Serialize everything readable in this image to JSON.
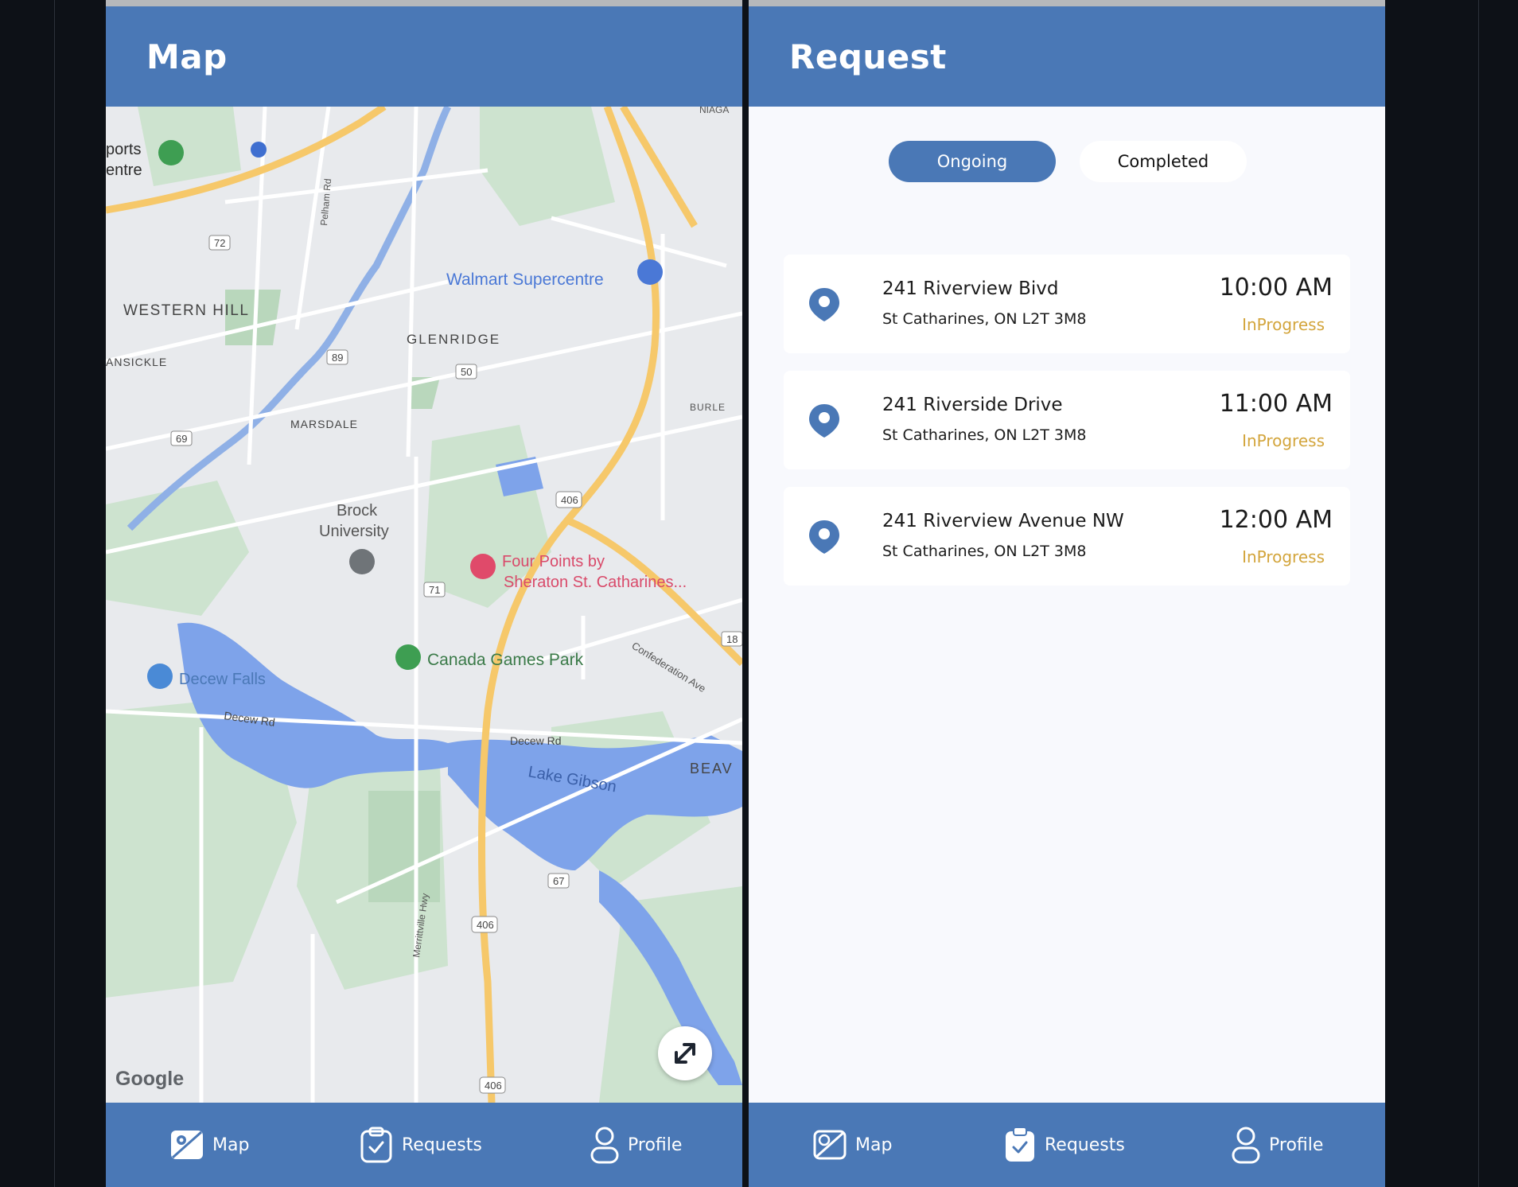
{
  "colors": {
    "brand_blue": "#4a78b6",
    "status_inprogress": "#d3a53c",
    "background_dark": "#0d1117",
    "screen_bg": "#f8f9fd"
  },
  "map_screen": {
    "title": "Map",
    "map_labels": {
      "sports_centre_1": "ports",
      "sports_centre_2": "entre",
      "western_hill": "WESTERN HILL",
      "glenridge": "GLENRIDGE",
      "ansickle": "ANSICKLE",
      "marsdale": "MARSDALE",
      "brock_1": "Brock",
      "brock_2": "University",
      "walmart": "Walmart Supercentre",
      "four_points_1": "Four Points by",
      "four_points_2": "Sheraton St. Catharines...",
      "canada_games": "Canada Games Park",
      "decew_falls": "Decew Falls",
      "decew_rd_1": "Decew Rd",
      "decew_rd_2": "Decew Rd",
      "lake_gibson": "Lake Gibson",
      "confederation": "Confederation Ave",
      "beav": "BEAV",
      "burle": "BURLE",
      "merrittville": "Merrittville Hwy",
      "pelham": "Pelham Rd",
      "niagara": "NIAGA",
      "hwy_406_a": "406",
      "hwy_406_b": "406",
      "hwy_406_c": "406",
      "rd_72": "72",
      "rd_89": "89",
      "rd_50": "50",
      "rd_69": "69",
      "rd_71": "71",
      "rd_67": "67",
      "rd_18": "18"
    },
    "google_logo": "Google",
    "nav": {
      "map": "Map",
      "requests": "Requests",
      "profile": "Profile"
    }
  },
  "request_screen": {
    "title": "Request",
    "tabs": {
      "ongoing": "Ongoing",
      "completed": "Completed"
    },
    "requests": [
      {
        "address": "241 Riverview Bivd",
        "city": "St Catharines, ON L2T 3M8",
        "time": "10:00 AM",
        "status": "InProgress"
      },
      {
        "address": "241 Riverside Drive",
        "city": "St Catharines, ON L2T 3M8",
        "time": "11:00 AM",
        "status": "InProgress"
      },
      {
        "address": "241 Riverview Avenue NW",
        "city": "St Catharines, ON L2T 3M8",
        "time": "12:00 AM",
        "status": "InProgress"
      }
    ],
    "nav": {
      "map": "Map",
      "requests": "Requests",
      "profile": "Profile"
    }
  }
}
